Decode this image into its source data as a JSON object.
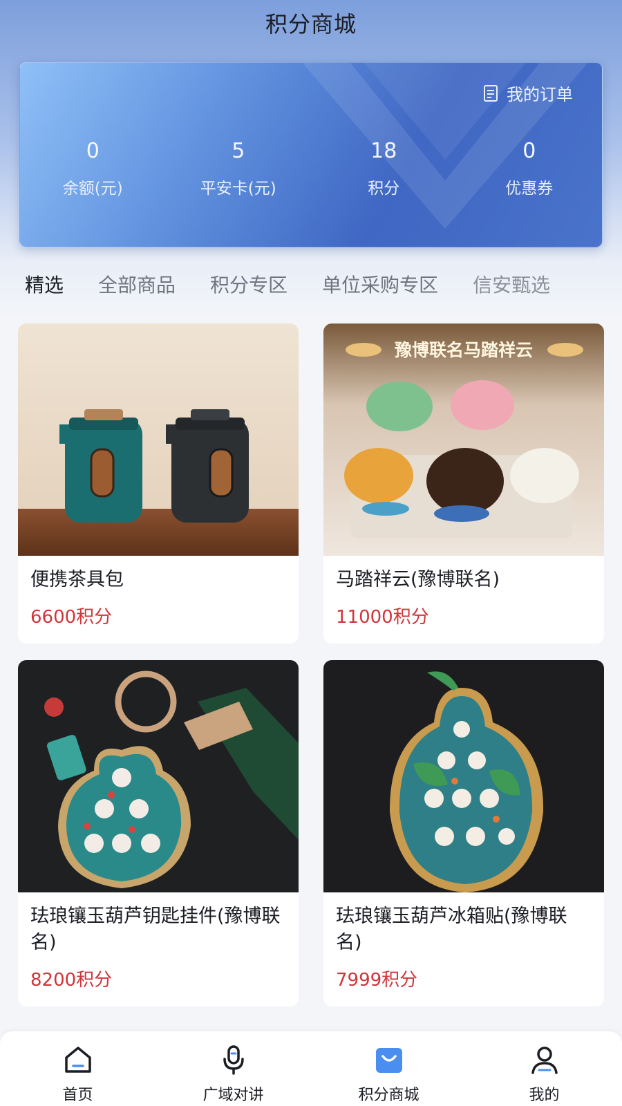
{
  "header": {
    "title": "积分商城"
  },
  "stats_card": {
    "orders_label": "我的订单",
    "stats": [
      {
        "value": "0",
        "label": "余额(元)"
      },
      {
        "value": "5",
        "label": "平安卡(元)"
      },
      {
        "value": "18",
        "label": "积分"
      },
      {
        "value": "0",
        "label": "优惠券"
      }
    ]
  },
  "tabs": [
    {
      "label": "精选"
    },
    {
      "label": "全部商品"
    },
    {
      "label": "积分专区"
    },
    {
      "label": "单位采购专区"
    },
    {
      "label": "信安甄选"
    }
  ],
  "products": [
    {
      "name": "便携茶具包",
      "price": "6600积分"
    },
    {
      "name": "马踏祥云(豫博联名)",
      "price": "11000积分",
      "banner": "豫博联名马踏祥云"
    },
    {
      "name": "珐琅镶玉葫芦钥匙挂件(豫博联名)",
      "price": "8200积分"
    },
    {
      "name": "珐琅镶玉葫芦冰箱贴(豫博联名)",
      "price": "7999积分"
    }
  ],
  "bottom_nav": [
    {
      "label": "首页",
      "icon": "home-icon"
    },
    {
      "label": "广域对讲",
      "icon": "microphone-icon"
    },
    {
      "label": "积分商城",
      "icon": "shopping-bag-icon"
    },
    {
      "label": "我的",
      "icon": "user-icon"
    }
  ],
  "colors": {
    "accent": "#4a8ef0",
    "price": "#d0353a",
    "card_start": "#8fc0f7",
    "card_end": "#3f67c3"
  }
}
